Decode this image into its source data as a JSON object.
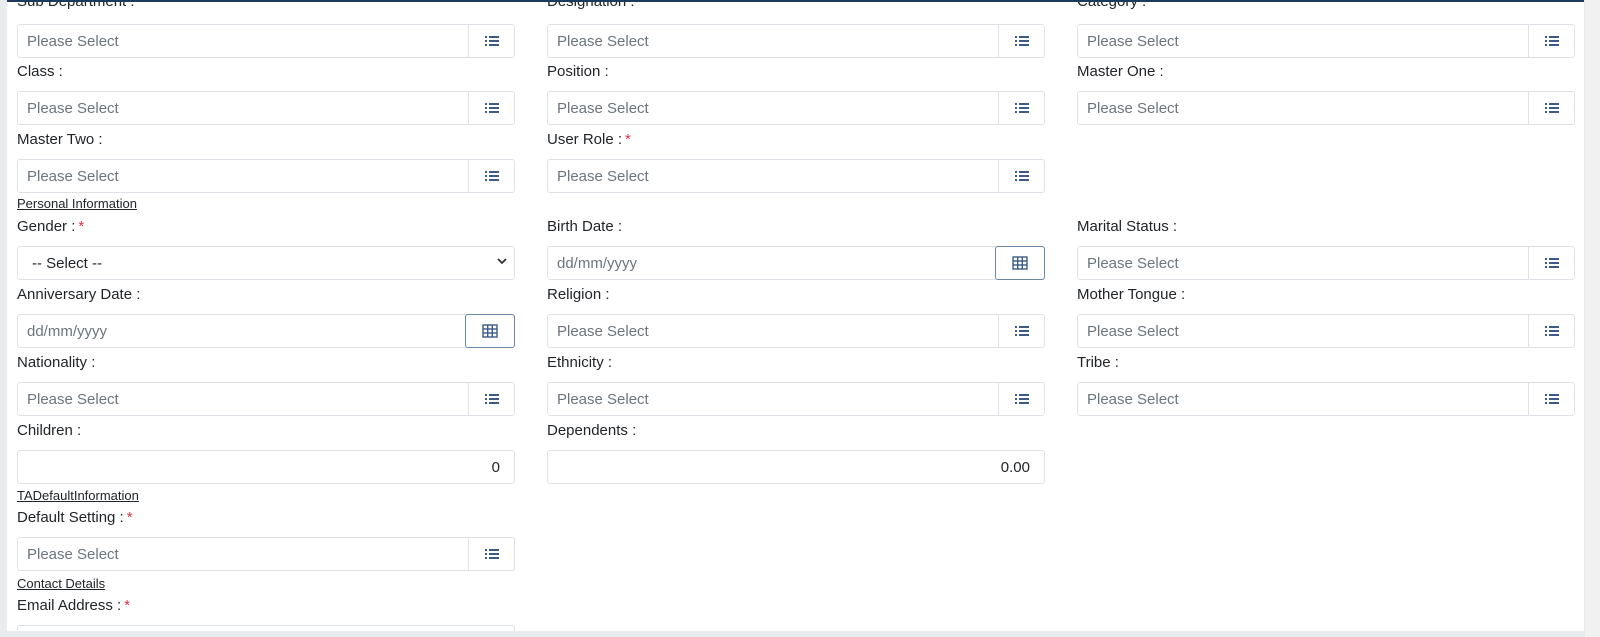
{
  "placeholders": {
    "select": "Please Select",
    "date": "dd/mm/yyyy",
    "dropdown": "-- Select --"
  },
  "fields": {
    "sub_department": "Sub Department :",
    "designation": "Designation :",
    "category": "Category :",
    "class": "Class :",
    "position": "Position :",
    "master_one": "Master One :",
    "master_two": "Master Two :",
    "user_role": "User Role :",
    "gender": "Gender :",
    "birth_date": "Birth Date :",
    "marital_status": "Marital Status :",
    "anniversary_date": "Anniversary Date :",
    "religion": "Religion :",
    "mother_tongue": "Mother Tongue :",
    "nationality": "Nationality :",
    "ethnicity": "Ethnicity :",
    "tribe": "Tribe :",
    "children": "Children :",
    "dependents": "Dependents :",
    "default_setting": "Default Setting :",
    "email_address": "Email Address :"
  },
  "values": {
    "children": "0",
    "dependents": "0.00"
  },
  "required_marker": "*",
  "sections": {
    "personal": "Personal Information",
    "ta_default": "TADefaultInformation",
    "contact": "Contact Details"
  },
  "colors": {
    "required": "#dc3545",
    "accent": "#1f3a5f"
  },
  "icons": {
    "list": "list-icon",
    "calendar": "calendar-icon",
    "dropdown": "chevron-down-icon"
  }
}
